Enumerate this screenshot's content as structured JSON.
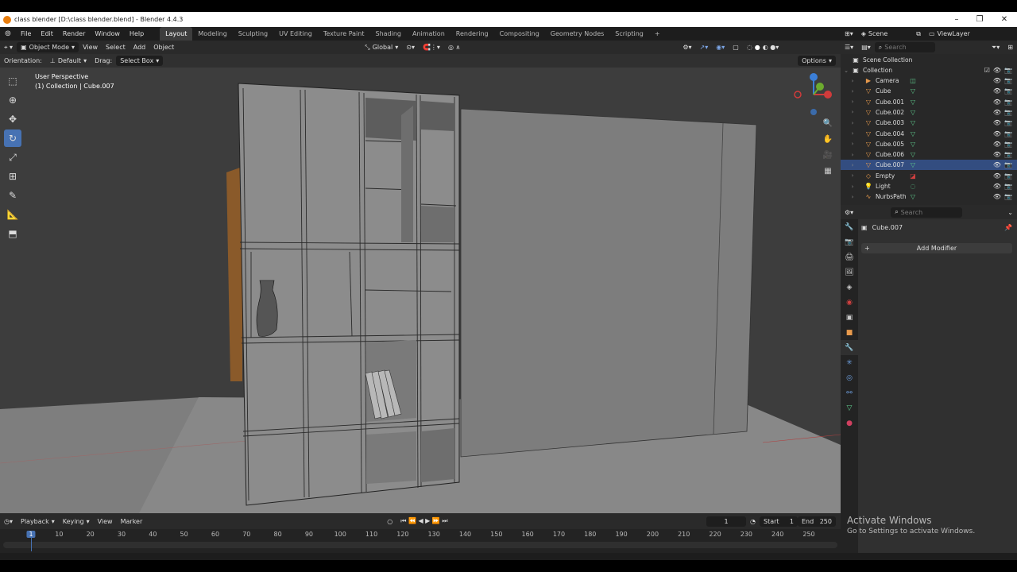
{
  "window": {
    "title": "class blender [D:\\class blender.blend] - Blender 4.4.3",
    "minimize": "–",
    "restore": "❐",
    "close": "✕"
  },
  "menu": {
    "items": [
      "File",
      "Edit",
      "Render",
      "Window",
      "Help"
    ]
  },
  "workspaces": [
    "Layout",
    "Modeling",
    "Sculpting",
    "UV Editing",
    "Texture Paint",
    "Shading",
    "Animation",
    "Rendering",
    "Compositing",
    "Geometry Nodes",
    "Scripting",
    "+"
  ],
  "scene": {
    "label": "Scene",
    "view_layer": "ViewLayer"
  },
  "viewport_header": {
    "mode": "Object Mode",
    "menus": [
      "View",
      "Select",
      "Add",
      "Object"
    ],
    "transform_orientation": "Global"
  },
  "tool_header": {
    "orientation_label": "Orientation:",
    "orientation_value": "Default",
    "drag_label": "Drag:",
    "drag_value": "Select Box",
    "options": "Options"
  },
  "viewport": {
    "perspective": "User Perspective",
    "collection_info": "(1) Collection | Cube.007"
  },
  "outliner": {
    "search_placeholder": "Search",
    "root": "Scene Collection",
    "collection": "Collection",
    "objects": [
      {
        "name": "Camera",
        "type": "camera"
      },
      {
        "name": "Cube",
        "type": "mesh"
      },
      {
        "name": "Cube.001",
        "type": "mesh"
      },
      {
        "name": "Cube.002",
        "type": "mesh"
      },
      {
        "name": "Cube.003",
        "type": "mesh"
      },
      {
        "name": "Cube.004",
        "type": "mesh"
      },
      {
        "name": "Cube.005",
        "type": "mesh"
      },
      {
        "name": "Cube.006",
        "type": "mesh"
      },
      {
        "name": "Cube.007",
        "type": "mesh"
      },
      {
        "name": "Empty",
        "type": "empty"
      },
      {
        "name": "Light",
        "type": "light"
      },
      {
        "name": "NurbsPath",
        "type": "curve"
      }
    ]
  },
  "properties": {
    "search_placeholder": "Search",
    "object_name": "Cube.007",
    "add_modifier": "Add Modifier"
  },
  "timeline": {
    "menus": [
      "Playback",
      "Keying",
      "View",
      "Marker"
    ],
    "current_frame": "1",
    "start_label": "Start",
    "start": "1",
    "end_label": "End",
    "end": "250",
    "ruler": [
      "1",
      "10",
      "20",
      "30",
      "40",
      "50",
      "60",
      "70",
      "80",
      "90",
      "100",
      "110",
      "120",
      "130",
      "140",
      "150",
      "160",
      "170",
      "180",
      "190",
      "200",
      "210",
      "220",
      "230",
      "240",
      "250"
    ]
  },
  "watermark": {
    "title": "Activate Windows",
    "subtitle": "Go to Settings to activate Windows."
  },
  "colors": {
    "accent": "#4772b3",
    "active_tab": "#3d3d3d",
    "selected_row": "#334d80"
  }
}
